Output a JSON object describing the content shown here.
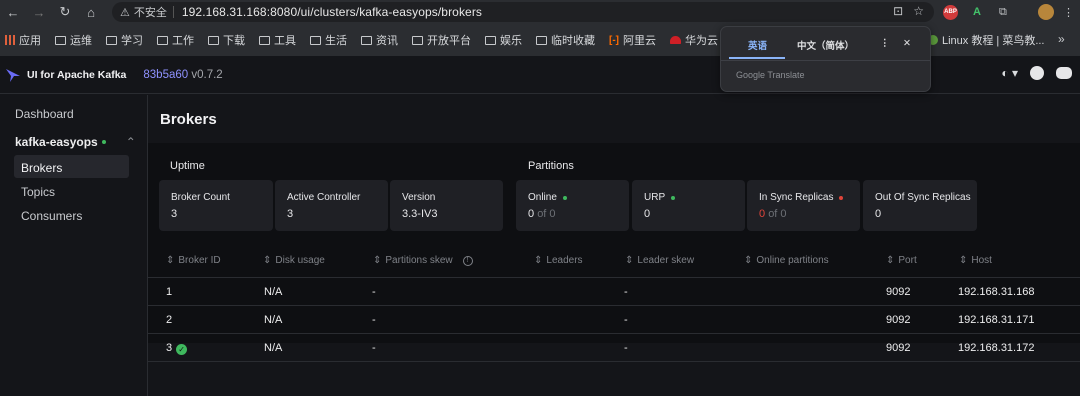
{
  "browser": {
    "security_label": "不安全",
    "url": "192.168.31.168:8080/ui/clusters/kafka-easyops/brokers",
    "extensions": {
      "abp": "ABP",
      "a": "A"
    },
    "bookmarks": [
      {
        "label": "应用",
        "icon": "apps-grid-icon"
      },
      {
        "label": "运维",
        "icon": "folder-icon"
      },
      {
        "label": "学习",
        "icon": "folder-icon"
      },
      {
        "label": "工作",
        "icon": "folder-icon"
      },
      {
        "label": "下载",
        "icon": "folder-icon"
      },
      {
        "label": "工具",
        "icon": "folder-icon"
      },
      {
        "label": "生活",
        "icon": "folder-icon"
      },
      {
        "label": "资讯",
        "icon": "folder-icon"
      },
      {
        "label": "开放平台",
        "icon": "folder-icon"
      },
      {
        "label": "娱乐",
        "icon": "folder-icon"
      },
      {
        "label": "临时收藏",
        "icon": "folder-icon"
      },
      {
        "label": "阿里云",
        "icon": "aliyun-icon"
      },
      {
        "label": "华为云",
        "icon": "huawei-icon"
      },
      {
        "label": "Linux 教程 | 菜鸟教...",
        "icon": "globe-icon"
      }
    ]
  },
  "translate_popup": {
    "tab_english": "英语",
    "tab_chinese": "中文（简体）",
    "footer": "Google Translate"
  },
  "app": {
    "name": "UI for Apache Kafka",
    "build_hash": "83b5a60",
    "version": "v0.7.2"
  },
  "sidebar": {
    "dashboard": "Dashboard",
    "cluster": "kafka-easyops",
    "items": [
      "Brokers",
      "Topics",
      "Consumers"
    ]
  },
  "page": {
    "title": "Brokers",
    "uptime_title": "Uptime",
    "partitions_title": "Partitions",
    "uptime_cards": [
      {
        "label": "Broker Count",
        "value": "3"
      },
      {
        "label": "Active Controller",
        "value": "3"
      },
      {
        "label": "Version",
        "value": "3.3-IV3"
      }
    ],
    "partition_cards": [
      {
        "label": "Online",
        "value": "0",
        "of": "of 0",
        "dot": "#3fb95e"
      },
      {
        "label": "URP",
        "value": "0",
        "of": "",
        "dot": "#3fb95e"
      },
      {
        "label": "In Sync Replicas",
        "value": "0",
        "of": "of 0",
        "dot": "#e0443a"
      },
      {
        "label": "Out Of Sync Replicas",
        "value": "0",
        "of": "",
        "dot": ""
      }
    ]
  },
  "table": {
    "headers": [
      "Broker ID",
      "Disk usage",
      "Partitions skew",
      "Leaders",
      "Leader skew",
      "Online partitions",
      "Port",
      "Host"
    ],
    "rows": [
      {
        "id": "1",
        "disk": "N/A",
        "skew": "-",
        "leaders": "",
        "leader_skew": "-",
        "online": "",
        "port": "9092",
        "host": "192.168.31.168",
        "controller": false
      },
      {
        "id": "2",
        "disk": "N/A",
        "skew": "-",
        "leaders": "",
        "leader_skew": "-",
        "online": "",
        "port": "9092",
        "host": "192.168.31.171",
        "controller": false
      },
      {
        "id": "3",
        "disk": "N/A",
        "skew": "-",
        "leaders": "",
        "leader_skew": "-",
        "online": "",
        "port": "9092",
        "host": "192.168.31.172",
        "controller": true
      }
    ]
  }
}
